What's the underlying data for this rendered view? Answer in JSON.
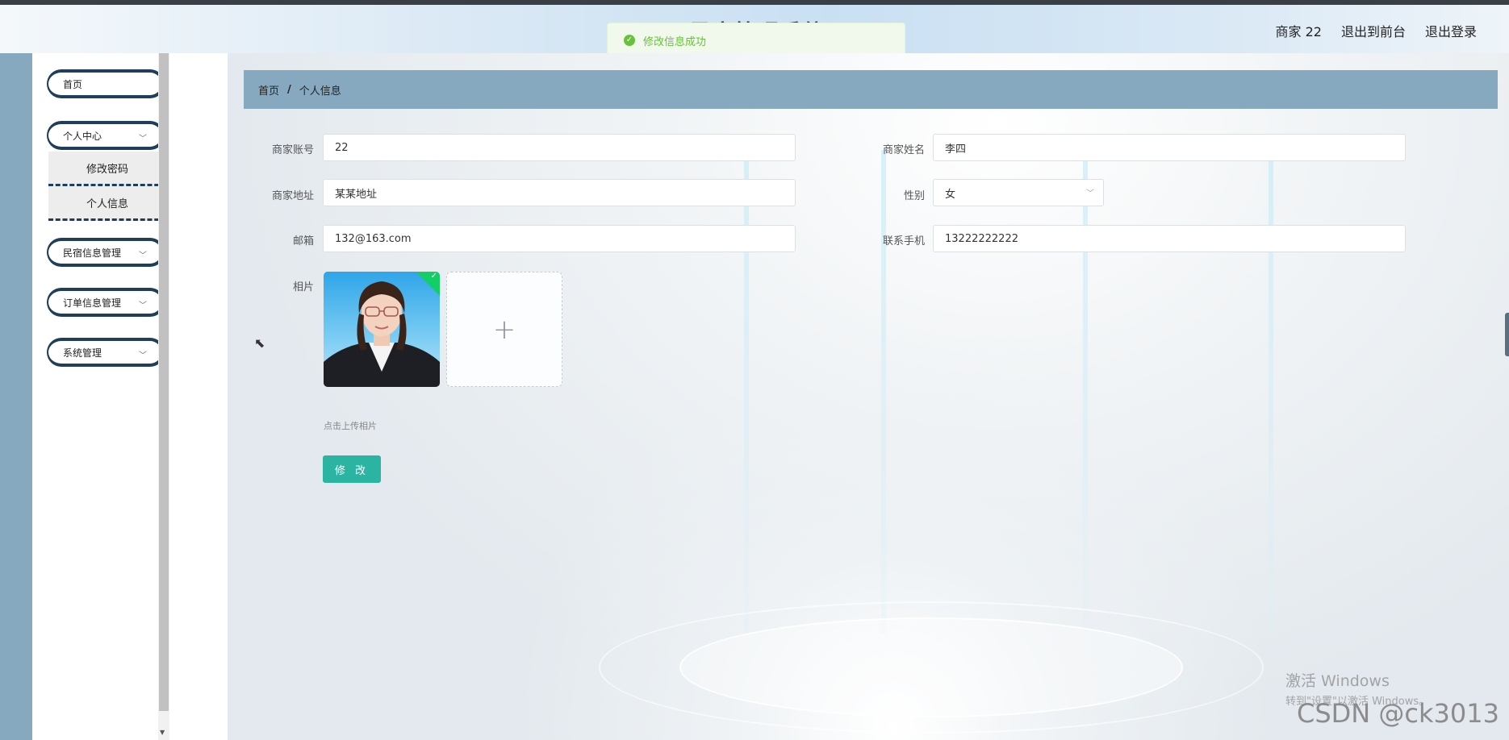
{
  "header": {
    "title": "民宿管理系统",
    "nav": [
      "商家 22",
      "退出到前台",
      "退出登录"
    ]
  },
  "toast": {
    "message": "修改信息成功",
    "icon": "success-check-icon",
    "color": "#67c23a"
  },
  "sidebar": {
    "home": "首页",
    "personal_center": "个人中心",
    "submenu": [
      "修改密码",
      "个人信息"
    ],
    "minsu_mgmt": "民宿信息管理",
    "order_mgmt": "订单信息管理",
    "system_mgmt": "系统管理"
  },
  "breadcrumb": {
    "home": "首页",
    "separator": "/",
    "current": "个人信息"
  },
  "form": {
    "account_label": "商家账号",
    "account_value": "22",
    "name_label": "商家姓名",
    "name_value": "李四",
    "address_label": "商家地址",
    "address_value": "某某地址",
    "gender_label": "性别",
    "gender_value": "女",
    "email_label": "邮箱",
    "email_value": "132@163.com",
    "phone_label": "联系手机",
    "phone_value": "13222222222",
    "photo_label": "相片",
    "upload_hint": "点击上传相片",
    "submit_label": "修 改"
  },
  "watermark": {
    "line1": "激活 Windows",
    "line2": "转到\"设置\"以激活 Windows。",
    "csdn": "CSDN @ck3013"
  },
  "colors": {
    "accent_blue": "#86a9bf",
    "navy": "#1f3e59",
    "button_teal": "#2bb4a1"
  }
}
